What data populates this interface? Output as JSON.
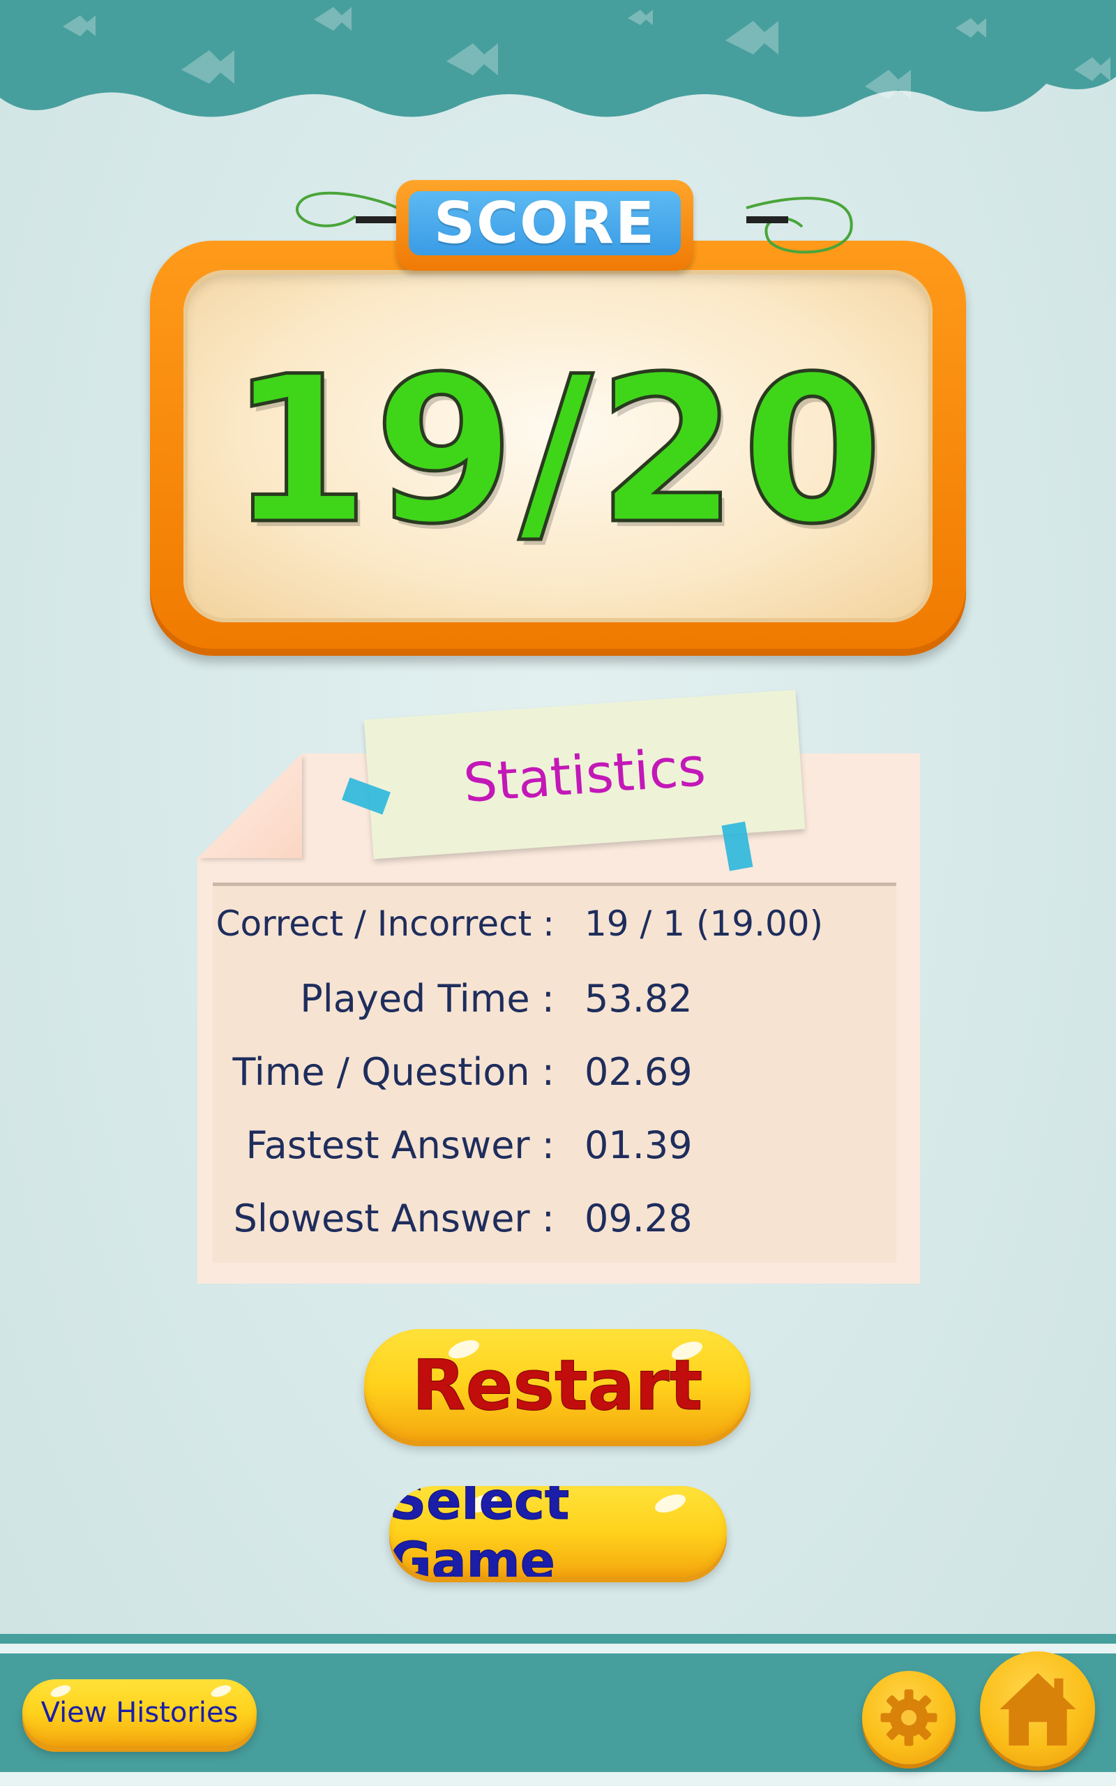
{
  "score": {
    "tag_label": "SCORE",
    "value": "19/20"
  },
  "statistics": {
    "title": "Statistics",
    "rows": [
      {
        "label": "Correct / Incorrect :",
        "value": "19 / 1 (19.00)"
      },
      {
        "label": "Played Time :",
        "value": "53.82"
      },
      {
        "label": "Time / Question :",
        "value": "02.69"
      },
      {
        "label": "Fastest Answer :",
        "value": "01.39"
      },
      {
        "label": "Slowest Answer :",
        "value": "09.28"
      }
    ]
  },
  "buttons": {
    "restart": "Restart",
    "select_game": "Select Game",
    "view_histories": "View Histories"
  },
  "icons": {
    "settings": "gear-icon",
    "home": "home-icon"
  },
  "colors": {
    "teal": "#479f9d",
    "orange_frame": "#f07a00",
    "score_green": "#3fd61a",
    "stats_title": "#c318b7",
    "restart_text": "#c20d0d",
    "navy_text": "#1e2d5c"
  }
}
